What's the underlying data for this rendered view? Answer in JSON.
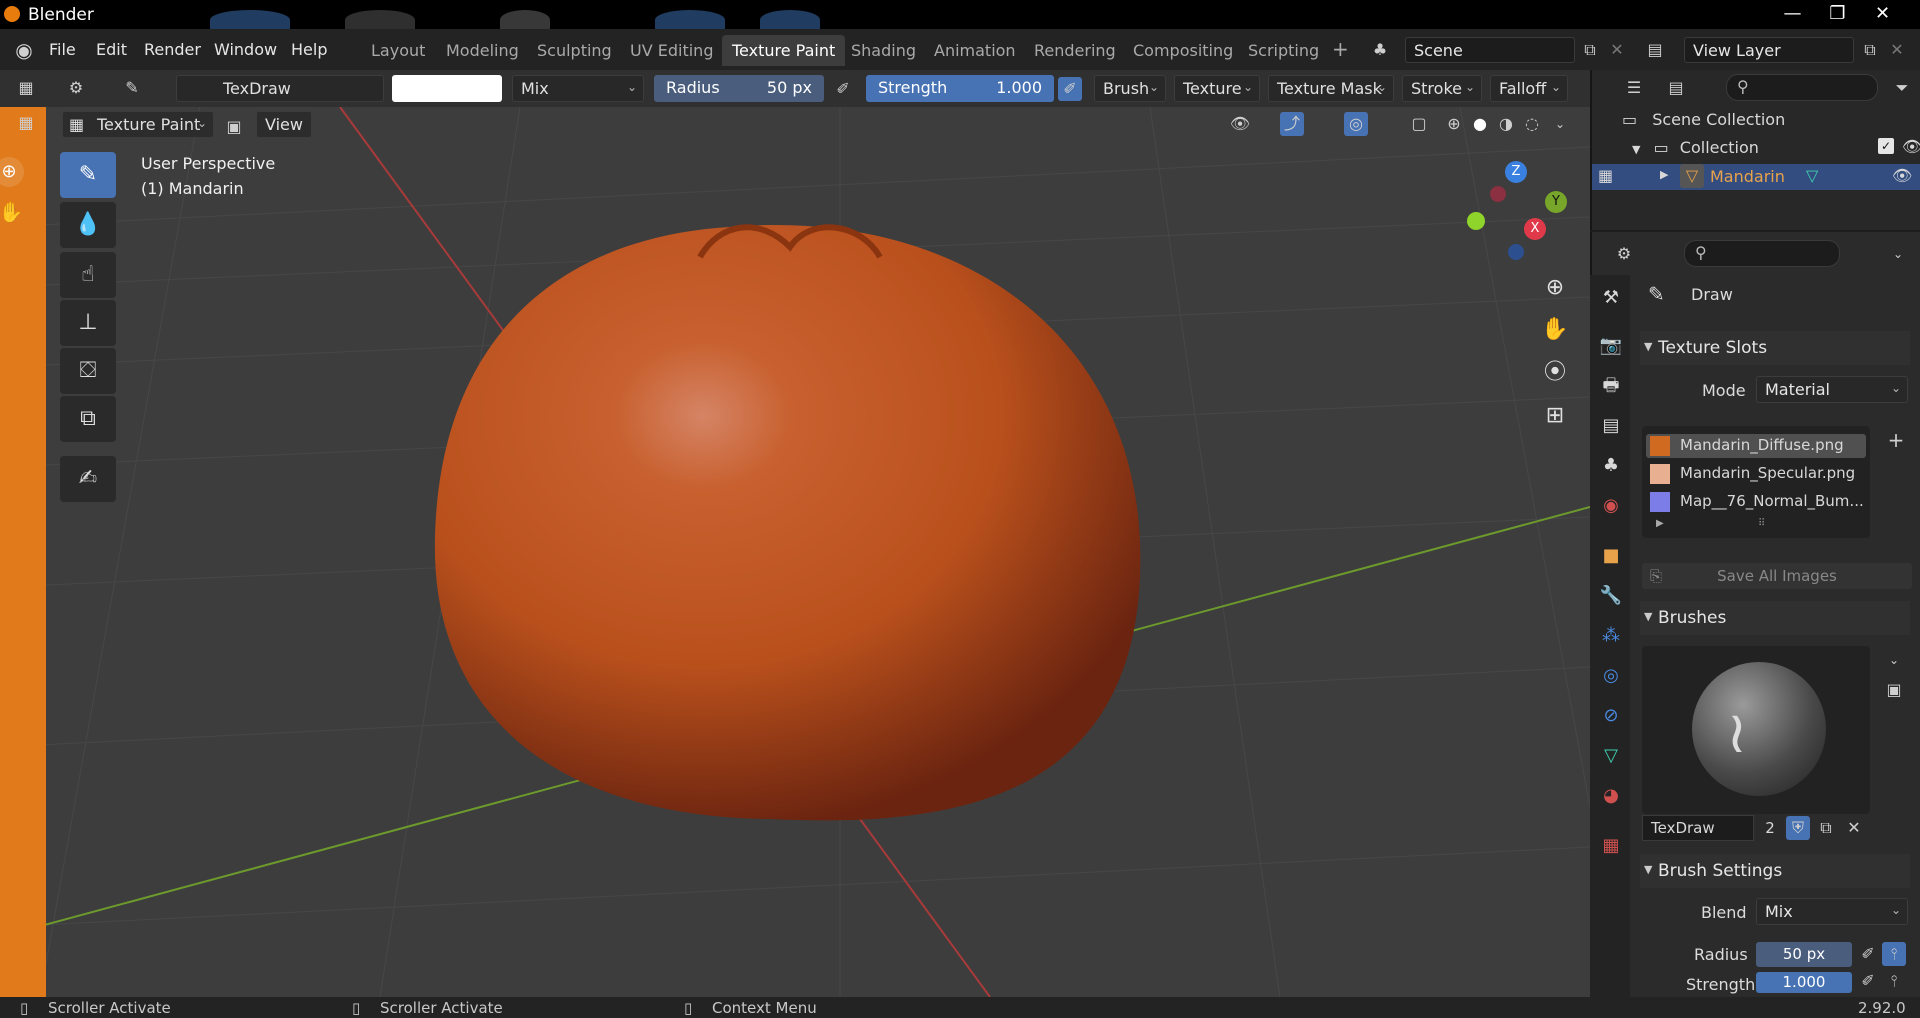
{
  "window": {
    "title": "Blender",
    "controls": [
      "—",
      "❐",
      "✕"
    ]
  },
  "menubar": {
    "menus": [
      "File",
      "Edit",
      "Render",
      "Window",
      "Help"
    ],
    "workspaces": [
      "Layout",
      "Modeling",
      "Sculpting",
      "UV Editing",
      "Texture Paint",
      "Shading",
      "Animation",
      "Rendering",
      "Compositing",
      "Scripting"
    ],
    "active_workspace": "Texture Paint",
    "add_workspace": "+",
    "scene": "Scene",
    "view_layer": "View Layer"
  },
  "tool_header": {
    "brush_name": "TexDraw",
    "blend": "Mix",
    "radius_label": "Radius",
    "radius_value": "50 px",
    "strength_label": "Strength",
    "strength_value": "1.000",
    "menus": [
      "Brush",
      "Texture",
      "Texture Mask",
      "Stroke",
      "Falloff"
    ]
  },
  "viewport_header": {
    "mode": "Texture Paint",
    "view_menu": "View"
  },
  "viewport": {
    "perspective_label": "User Perspective",
    "object_label": "(1) Mandarin",
    "gizmo": {
      "z": "Z",
      "y": "Y",
      "x": "X"
    }
  },
  "outliner": {
    "scene_collection": "Scene Collection",
    "collection": "Collection",
    "object": "Mandarin"
  },
  "properties": {
    "tool_name": "Draw",
    "texture_slots": {
      "title": "Texture Slots",
      "mode_label": "Mode",
      "mode_value": "Material",
      "slots": [
        "Mandarin_Diffuse.png",
        "Mandarin_Specular.png",
        "Map__76_Normal_Bum..."
      ],
      "save_all": "Save All Images"
    },
    "brushes": {
      "title": "Brushes",
      "brush_name": "TexDraw",
      "users": "2"
    },
    "brush_settings": {
      "title": "Brush Settings",
      "blend_label": "Blend",
      "blend_value": "Mix",
      "radius_label": "Radius",
      "radius_value": "50 px",
      "strength_label": "Strength",
      "strength_value": "1.000"
    }
  },
  "statusbar": {
    "left": "Scroller Activate",
    "middle": "Scroller Activate",
    "right": "Context Menu",
    "version": "2.92.0"
  },
  "colors": {
    "accent": "#4772b3",
    "active_object": "#e8a24a",
    "grid_red": "#a83a3a",
    "grid_green": "#6d9a2c",
    "mandarin": "#c9561c"
  }
}
